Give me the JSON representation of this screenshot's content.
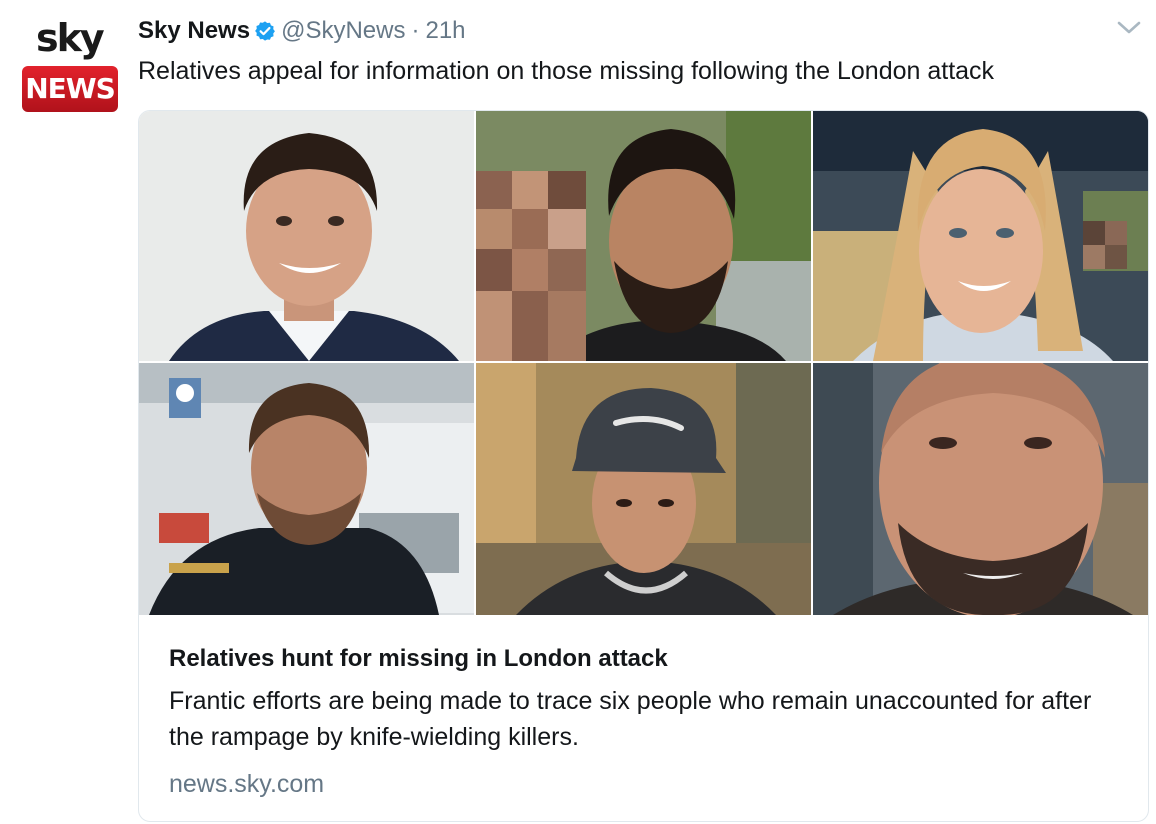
{
  "tweet": {
    "author": {
      "display_name": "Sky News",
      "handle": "@SkyNews",
      "verified": true,
      "avatar": {
        "line1": "sky",
        "line2": "NEWS"
      }
    },
    "separator": "·",
    "timestamp": "21h",
    "text": "Relatives appeal for information on those missing following the London attack",
    "menu_icon": "chevron-down-icon"
  },
  "card": {
    "photos": [
      {
        "label": "man in suit smiling"
      },
      {
        "label": "bearded man selfie with pixelated face"
      },
      {
        "label": "woman with blonde hair smiling"
      },
      {
        "label": "man in dark jacket near building"
      },
      {
        "label": "young man in grey cap"
      },
      {
        "label": "bald bearded man close-up"
      }
    ],
    "title": "Relatives hunt for missing in London attack",
    "description": "Frantic efforts are being made to trace six people who remain unaccounted for after the rampage by knife-wielding killers.",
    "domain": "news.sky.com"
  },
  "colors": {
    "text_primary": "#14171a",
    "text_secondary": "#657786",
    "verified_blue": "#1da1f2",
    "border": "#e1e8ed",
    "sky_red": "#d11a24"
  }
}
